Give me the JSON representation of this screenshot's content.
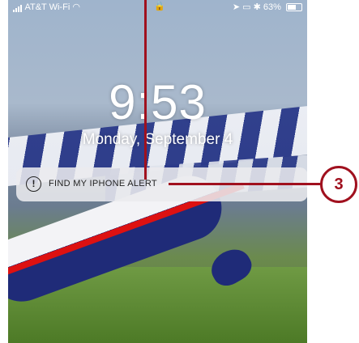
{
  "status_bar": {
    "carrier": "AT&T Wi-Fi",
    "battery": "63%",
    "battery_level": 0.63,
    "icons": [
      "signal-icon",
      "wifi-icon",
      "lock-icon",
      "location-icon",
      "screen-mirror-icon",
      "bluetooth-icon",
      "battery-icon"
    ]
  },
  "lock_screen": {
    "time": "9:53",
    "date": "Monday, September 4"
  },
  "notification": {
    "icon": "alert-icon",
    "title": "FIND MY IPHONE ALERT"
  },
  "callout": {
    "number": "3",
    "color": "#a0101e"
  }
}
